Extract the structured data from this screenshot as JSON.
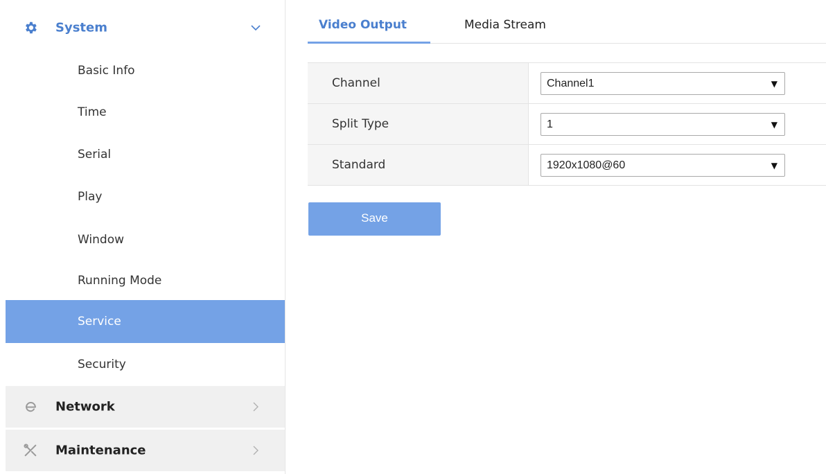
{
  "sidebar": {
    "system": {
      "label": "System",
      "icon": "gear-icon",
      "expanded": true
    },
    "items": [
      {
        "label": "Basic Info"
      },
      {
        "label": "Time"
      },
      {
        "label": "Serial"
      },
      {
        "label": "Play"
      },
      {
        "label": "Window"
      },
      {
        "label": "Running Mode"
      },
      {
        "label": "Service",
        "active": true
      },
      {
        "label": "Security"
      }
    ],
    "network": {
      "label": "Network",
      "icon": "network-e-icon"
    },
    "maintenance": {
      "label": "Maintenance",
      "icon": "tools-icon"
    }
  },
  "tabs": [
    {
      "label": "Video Output",
      "active": true
    },
    {
      "label": "Media Stream",
      "active": false
    }
  ],
  "form": {
    "rows": [
      {
        "label": "Channel",
        "value": "Channel1"
      },
      {
        "label": "Split Type",
        "value": "1"
      },
      {
        "label": "Standard",
        "value": "1920x1080@60"
      }
    ],
    "save_label": "Save"
  },
  "colors": {
    "accent": "#74a2e6",
    "accent_text": "#4a7fce",
    "collapsed_bg": "#f0f0f0",
    "label_cell_bg": "#f5f5f5"
  }
}
